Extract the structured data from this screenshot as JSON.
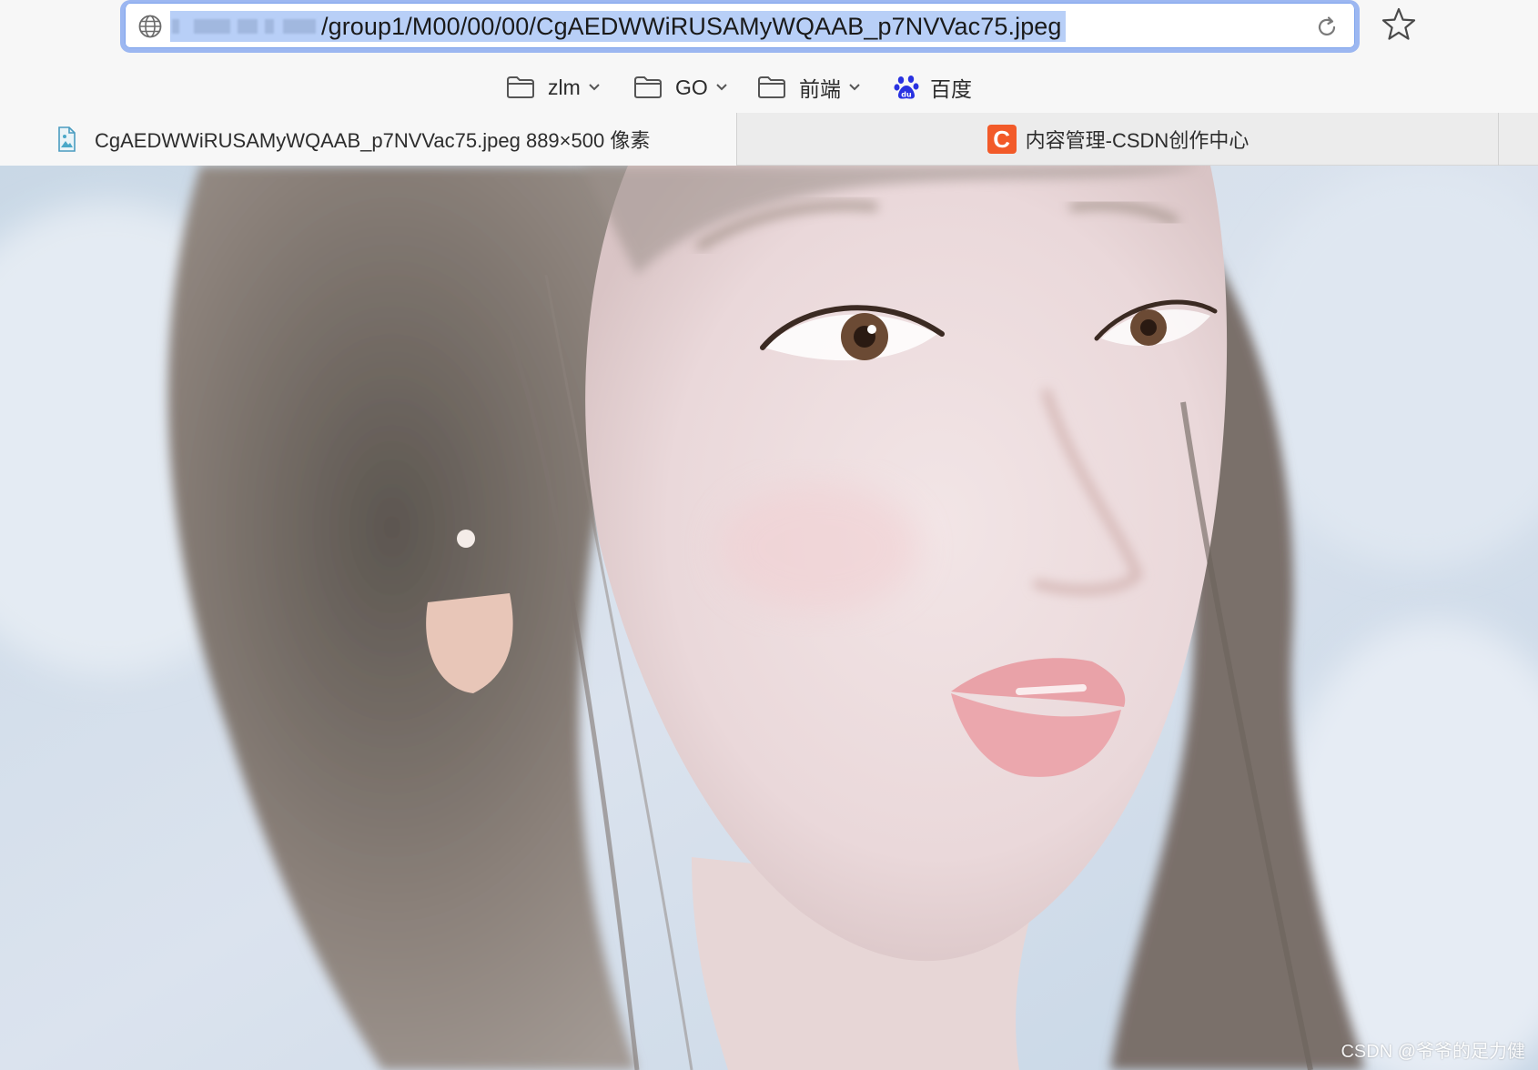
{
  "address_bar": {
    "url_path": "/group1/M00/00/00/CgAEDWWiRUSAMyWQAAB_p7NVVac75.jpeg"
  },
  "bookmarks": [
    {
      "label": "zlm",
      "icon": "folder-icon"
    },
    {
      "label": "GO",
      "icon": "folder-icon"
    },
    {
      "label": "前端",
      "icon": "folder-icon"
    },
    {
      "label": "百度",
      "icon": "baidu-paw-icon"
    }
  ],
  "tabs": [
    {
      "title": "CgAEDWWiRUSAMyWQAAB_p7NVVac75.jpeg 889×500 像素",
      "active": true
    },
    {
      "title": "内容管理-CSDN创作中心",
      "active": false,
      "favicon_text": "C"
    }
  ],
  "watermark": "CSDN @爷爷的足力健",
  "colors": {
    "selection": "#b8cff7",
    "focus_ring": "#9cb7f1",
    "csdn_brand": "#f25a29",
    "baidu_brand": "#2932e1"
  }
}
